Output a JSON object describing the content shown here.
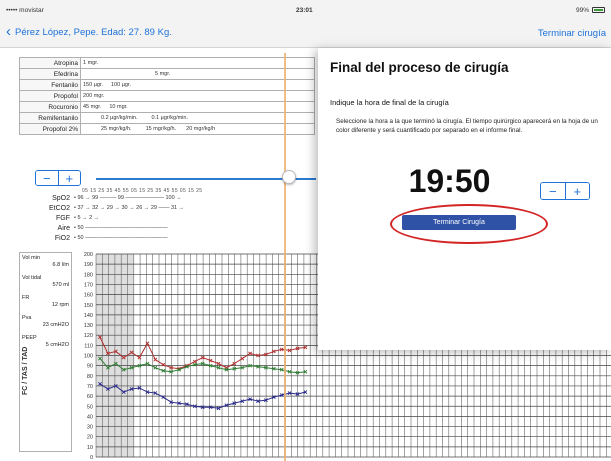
{
  "status": {
    "carrier": "••••• movistar",
    "time": "23:01",
    "battery": "99%"
  },
  "nav": {
    "back_label": "Pérez López, Pepe. Edad: 27. 89 Kg.",
    "finish_label": "Terminar cirugía"
  },
  "drugs": [
    {
      "name": "Atropina",
      "doses": [
        "1 mgr."
      ]
    },
    {
      "name": "Efedrina",
      "doses": [
        "5 mgr."
      ]
    },
    {
      "name": "Fentanilo",
      "doses": [
        "150 µgr.",
        "100 µgr."
      ]
    },
    {
      "name": "Propofol",
      "doses": [
        "200 mgr."
      ]
    },
    {
      "name": "Rocuronio",
      "doses": [
        "45 mgr.",
        "10 mgr."
      ]
    },
    {
      "name": "Remifentanilo",
      "doses": [
        "0.2 µgr/kg/min.",
        "0.1 µgr/kg/min."
      ]
    },
    {
      "name": "Propofol 2%",
      "doses": [
        "25 mgr/kg/h.",
        "15 mgr/kg/h.",
        "20 mgr/kg/h"
      ]
    }
  ],
  "time_axis": "05 15 25 35 45 55 05 15 25 35 45 55 05 15 25",
  "gases": [
    {
      "name": "SpO2",
      "values": "• 96 → 99 ——— 99 ——————— 100 →"
    },
    {
      "name": "EtCO2",
      "values": "• 37 → 32 → 29 → 30 → 26 → 29 —— 31 →"
    },
    {
      "name": "FGF",
      "values": "• 5 → 2 →"
    },
    {
      "name": "Aire",
      "values": "• 50 ———————————————"
    },
    {
      "name": "FiO2",
      "values": "• 50 ———————————————"
    }
  ],
  "vent": [
    {
      "label": "Vol min",
      "unit": "6.8 l/m"
    },
    {
      "label": "Vol tidal",
      "unit": "570 ml"
    },
    {
      "label": "FR",
      "unit": "12 rpm"
    },
    {
      "label": "Pva",
      "unit": "23 cmH2O"
    },
    {
      "label": "PEEP",
      "unit": "5 cmH2O"
    }
  ],
  "y_axis_ticks": [
    "200",
    "190",
    "180",
    "170",
    "160",
    "150",
    "140",
    "130",
    "120",
    "110",
    "100",
    "90",
    "80",
    "70",
    "60",
    "50",
    "40",
    "30",
    "20",
    "10",
    "0"
  ],
  "y_axis_title": "FC / TAS / TAD",
  "modal": {
    "title": "Final del proceso de cirugía",
    "subtitle": "Indique la hora de final de la cirugía",
    "info": "Seleccione la hora a la que terminó la cirugía. El tiempo quirúrgico aparecerá en la hoja de un color diferente y será cuantificado por separado en el informe final.",
    "time": "19:50",
    "minus_label": "−",
    "plus_label": "+",
    "button_label": "Terminar Cirugía"
  },
  "stepper": {
    "minus_label": "−",
    "plus_label": "+"
  },
  "colors": {
    "accent": "#1e72d8",
    "button": "#2f52a6",
    "highlight": "#d32323",
    "sys": "#b03030",
    "hr": "#2e7d32",
    "dia": "#2a2a8a"
  },
  "chart_data": {
    "type": "line",
    "ylim": [
      0,
      200
    ],
    "series": [
      {
        "name": "TAS",
        "values": [
          118,
          102,
          104,
          98,
          103,
          98,
          112,
          96,
          91,
          88,
          87,
          90,
          94,
          98,
          95,
          92,
          88,
          92,
          97,
          102,
          100,
          101,
          104,
          106,
          105,
          107,
          108
        ]
      },
      {
        "name": "FC",
        "values": [
          97,
          88,
          92,
          86,
          88,
          90,
          92,
          88,
          85,
          84,
          86,
          89,
          91,
          92,
          90,
          88,
          86,
          87,
          88,
          90,
          89,
          88,
          87,
          86,
          84,
          83,
          84
        ]
      },
      {
        "name": "TAD",
        "values": [
          72,
          67,
          70,
          64,
          67,
          68,
          64,
          63,
          59,
          54,
          53,
          52,
          50,
          49,
          49,
          48,
          51,
          53,
          55,
          57,
          55,
          56,
          59,
          61,
          63,
          62,
          64
        ]
      }
    ]
  }
}
